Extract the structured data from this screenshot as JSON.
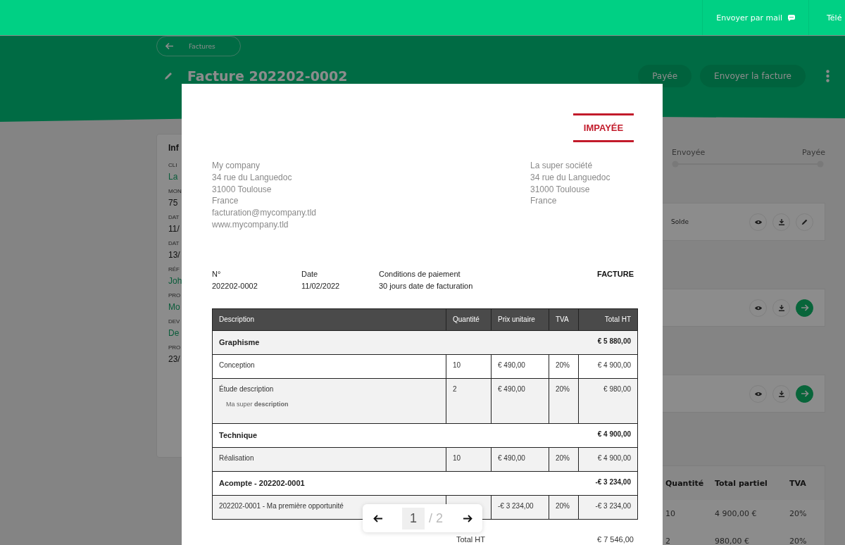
{
  "top_bar": {
    "mail_button": {
      "label": "Envoyer par mail"
    },
    "download_button": {
      "label": "Télé"
    }
  },
  "header": {
    "back_label": "Factures",
    "title": "Facture 202202-0002",
    "buttons": [
      "Payée",
      "Envoyer la facture"
    ]
  },
  "info_card": {
    "title": "Inf",
    "fields": [
      {
        "label": "CLI",
        "value": "La",
        "link": true
      },
      {
        "label": "MON",
        "value": "75",
        "link": false
      },
      {
        "label": "DAT",
        "value": "11/",
        "link": false
      },
      {
        "label": "DAT",
        "value": "13/",
        "link": false
      },
      {
        "label": "RÉF",
        "value": "Joh",
        "link": true
      },
      {
        "label": "PRO",
        "value": "Mo",
        "link": true
      },
      {
        "label": "DEV",
        "value": "De",
        "link": true
      },
      {
        "label": "PRO",
        "value": "23/",
        "link": false
      }
    ]
  },
  "timeline": {
    "steps": [
      "Envoyée",
      "Payée"
    ]
  },
  "documents": [
    {
      "kind": "edit",
      "label": "Solde"
    },
    {
      "kind": "next"
    },
    {
      "kind": "next"
    }
  ],
  "summary_table": {
    "columns": [
      "Quantité",
      "Total partiel",
      "TVA"
    ],
    "rows": [
      [
        "10",
        "4 900,00 €",
        "20%"
      ],
      [
        "2",
        "980,00 €",
        "20%"
      ]
    ]
  },
  "invoice": {
    "status": "IMPAYÉE",
    "seller": [
      "My company",
      "34 rue du Languedoc",
      "31000 Toulouse",
      "France",
      "facturation@mycompany.tld",
      "www.mycompany.tld"
    ],
    "client": [
      "La super société",
      "34 rue du Languedoc",
      "31000 Toulouse",
      "France"
    ],
    "meta": [
      {
        "label": "N°",
        "value": "202202-0002"
      },
      {
        "label": "Date",
        "value": "11/02/2022"
      },
      {
        "label": "Conditions de paiement",
        "value": "30 jours date de facturation"
      }
    ],
    "doc_type": "FACTURE",
    "table": {
      "columns": [
        "Description",
        "Quantité",
        "Prix unitaire",
        "TVA",
        "Total HT"
      ],
      "rows": [
        {
          "kind": "group",
          "description": "Graphisme",
          "total": "€ 5 880,00"
        },
        {
          "kind": "line",
          "description": "Conception",
          "quantity": "10",
          "unit_price": "€  490,00",
          "vat": "20%",
          "total": "€  4 900,00"
        },
        {
          "kind": "line",
          "description": "Étude description",
          "note": "Ma super **description**",
          "quantity": "2",
          "unit_price": "€  490,00",
          "vat": "20%",
          "total": "€  980,00"
        },
        {
          "kind": "group",
          "description": "Technique",
          "total": "€ 4 900,00"
        },
        {
          "kind": "line",
          "description": "Réalisation",
          "quantity": "10",
          "unit_price": "€  490,00",
          "vat": "20%",
          "total": "€  4 900,00"
        },
        {
          "kind": "group",
          "description": "Acompte - 202202-0001",
          "total": "-€ 3 234,00"
        },
        {
          "kind": "line",
          "description": "202202-0001 - Ma première opportunité",
          "unit_price": "-€  3 234,00",
          "vat": "20%",
          "total": "-€  3 234,00"
        }
      ]
    },
    "totals": [
      {
        "label": "Total HT",
        "value": "€  7 546,00"
      }
    ],
    "pager": {
      "page": "1",
      "of": "/ 2"
    }
  }
}
